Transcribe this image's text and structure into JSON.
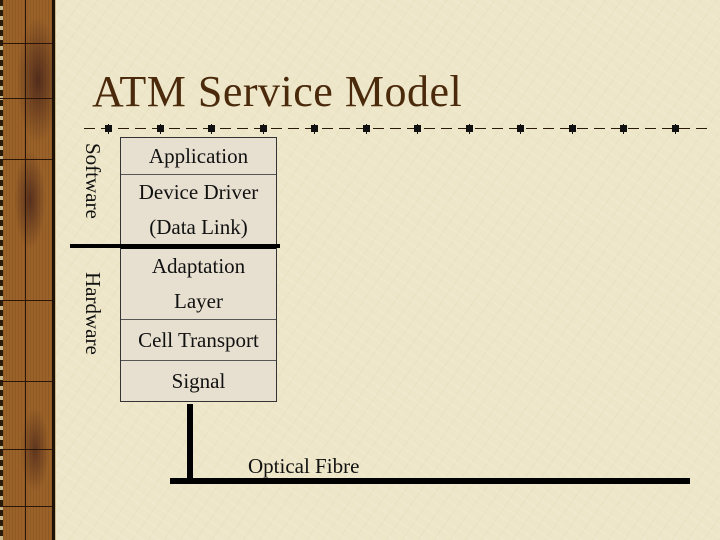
{
  "slide": {
    "title": "ATM Service Model",
    "side_labels": {
      "software": "Software",
      "hardware": "Hardware"
    },
    "layers": [
      {
        "id": "application",
        "lines": [
          "Application"
        ]
      },
      {
        "id": "device-driver",
        "lines": [
          "Device Driver",
          "(Data Link)"
        ]
      },
      {
        "id": "adaptation-layer",
        "lines": [
          "Adaptation",
          "Layer"
        ]
      },
      {
        "id": "cell-transport",
        "lines": [
          "Cell Transport"
        ]
      },
      {
        "id": "signal",
        "lines": [
          "Signal"
        ]
      }
    ],
    "medium_label": "Optical Fibre"
  },
  "theme": {
    "title_color": "#4b2a0c",
    "background": "#ede6c8",
    "strip_color": "#9a6128",
    "box_fill": "#e7dfd0"
  }
}
